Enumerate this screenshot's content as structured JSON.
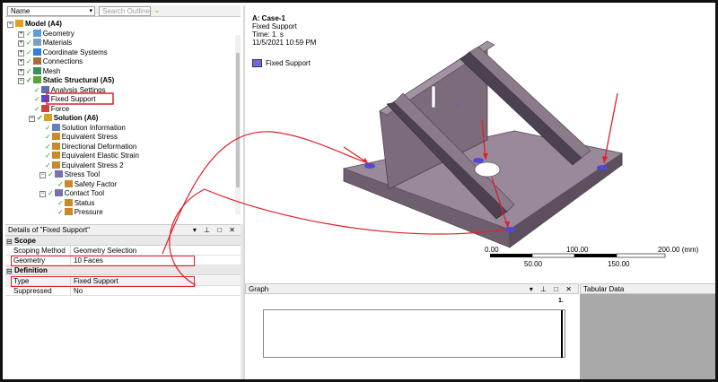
{
  "outline": {
    "name_select": "Name",
    "search_placeholder": "Search Outline",
    "tree": [
      {
        "label": "Model (A4)",
        "bold": true
      },
      {
        "label": "Geometry"
      },
      {
        "label": "Materials"
      },
      {
        "label": "Coordinate Systems"
      },
      {
        "label": "Connections"
      },
      {
        "label": "Mesh"
      },
      {
        "label": "Static Structural (A5)",
        "bold": true
      },
      {
        "label": "Analysis Settings"
      },
      {
        "label": "Fixed Support"
      },
      {
        "label": "Force"
      },
      {
        "label": "Solution (A6)",
        "bold": true
      },
      {
        "label": "Solution Information"
      },
      {
        "label": "Equivalent Stress"
      },
      {
        "label": "Directional Deformation"
      },
      {
        "label": "Equivalent Elastic Strain"
      },
      {
        "label": "Equivalent Stress 2"
      },
      {
        "label": "Stress Tool"
      },
      {
        "label": "Safety Factor"
      },
      {
        "label": "Contact Tool"
      },
      {
        "label": "Status"
      },
      {
        "label": "Pressure"
      }
    ]
  },
  "details": {
    "title": "Details of \"Fixed Support\"",
    "controls": "▾ ⊥ □ ✕",
    "groups": {
      "scope": "Scope",
      "definition": "Definition"
    },
    "rows": {
      "scoping_method": {
        "key": "Scoping Method",
        "value": "Geometry Selection"
      },
      "geometry": {
        "key": "Geometry",
        "value": "10 Faces"
      },
      "type": {
        "key": "Type",
        "value": "Fixed Support"
      },
      "suppressed": {
        "key": "Suppressed",
        "value": "No"
      }
    }
  },
  "viewport": {
    "case_title": "A: Case-1",
    "load_name": "Fixed Support",
    "time": "Time: 1. s",
    "date": "11/5/2021 10:59 PM",
    "legend_label": "Fixed Support",
    "scale_ticks_top": [
      "0.00",
      "100.00",
      "200.00 (mm)"
    ],
    "scale_ticks_bottom": [
      "50.00",
      "150.00"
    ]
  },
  "graph": {
    "title": "Graph",
    "controls": "▾ ⊥ □ ✕",
    "marker": "1."
  },
  "tabular": {
    "title": "Tabular Data"
  },
  "colors": {
    "highlight": "#e0202a",
    "support": "#6d6ade",
    "part": "#8d7c8d"
  }
}
